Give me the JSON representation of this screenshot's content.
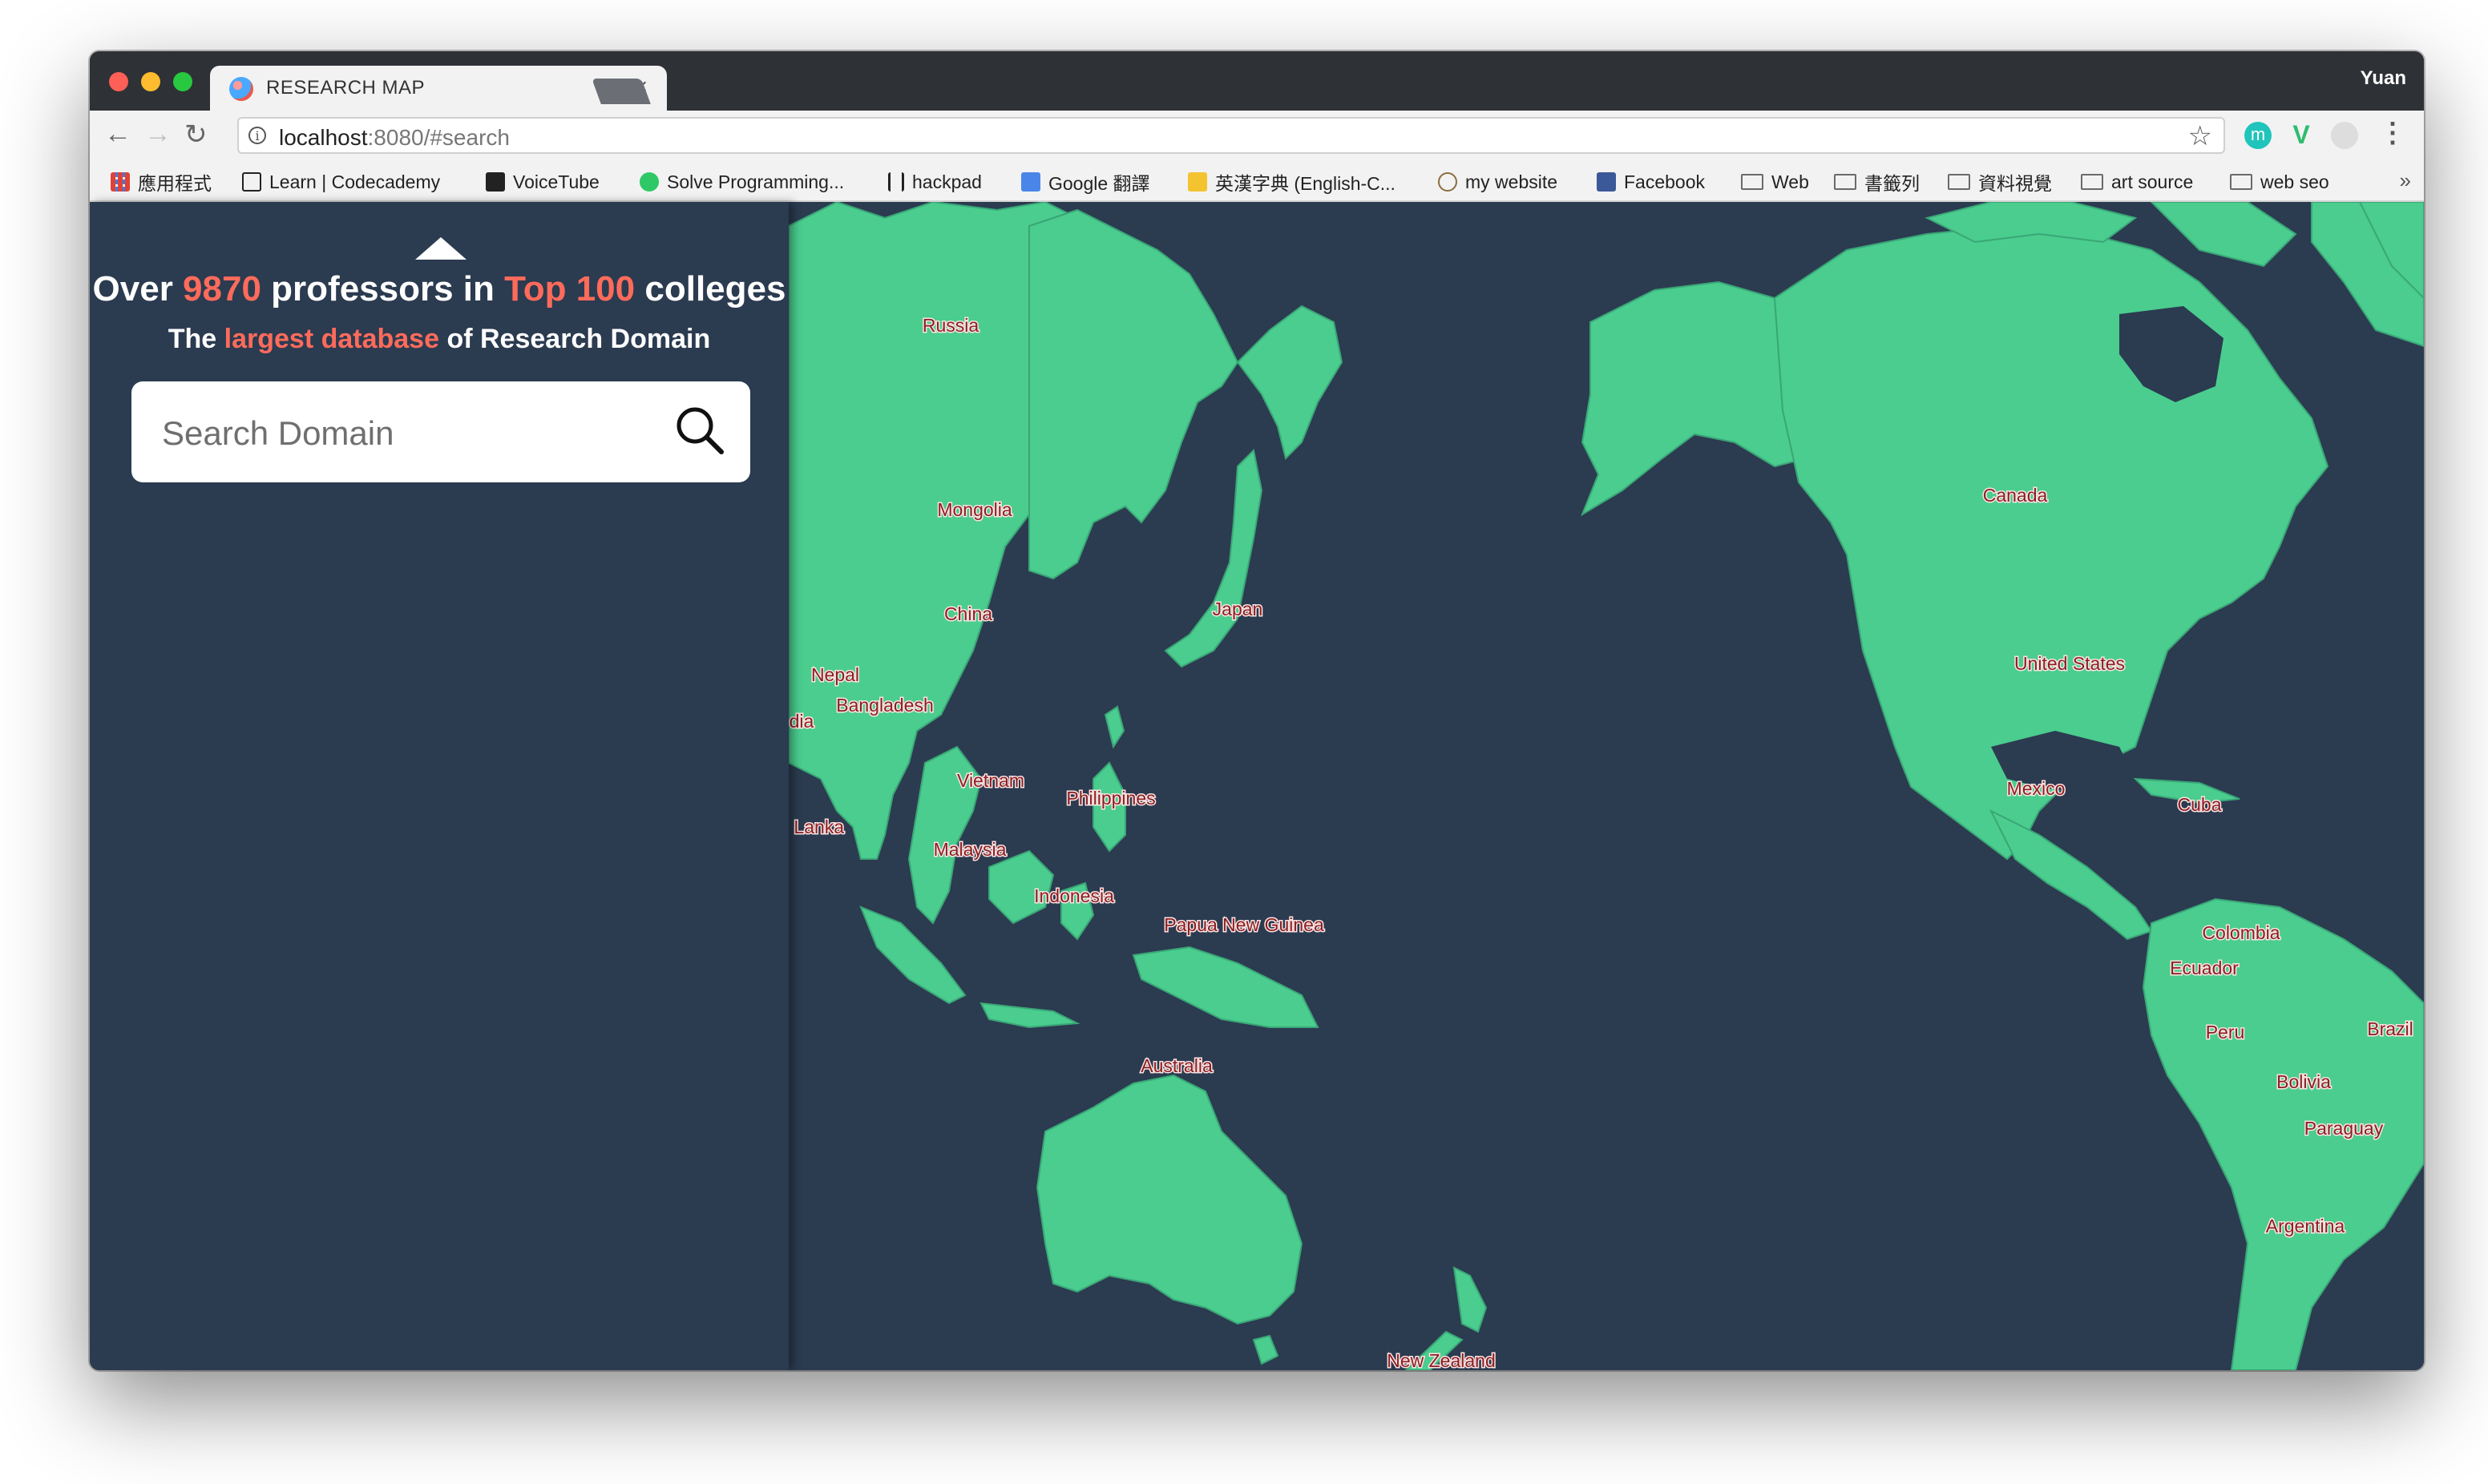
{
  "browser": {
    "tab_title": "RESEARCH MAP",
    "tab_close": "×",
    "profile_name": "Yuan",
    "url_host": "localhost",
    "url_rest": ":8080/#search",
    "nav_back": "←",
    "nav_forward": "→",
    "nav_reload": "↻",
    "star": "☆",
    "menu": "⋮",
    "ext1": "m",
    "ext2": "V",
    "bookmarks_more": "»",
    "bookmarks": [
      {
        "label": "應用程式",
        "icon": "apps-grid-icon"
      },
      {
        "label": "Learn | Codecademy",
        "icon": "codecademy-icon"
      },
      {
        "label": "VoiceTube",
        "icon": "voicetube-icon"
      },
      {
        "label": "Solve Programming...",
        "icon": "hackerrank-icon"
      },
      {
        "label": "hackpad",
        "icon": "hackpad-icon"
      },
      {
        "label": "Google 翻譯",
        "icon": "google-translate-icon"
      },
      {
        "label": "英漢字典 (English-C...",
        "icon": "dictionary-icon"
      },
      {
        "label": "my website",
        "icon": "website-icon"
      },
      {
        "label": "Facebook",
        "icon": "facebook-icon"
      },
      {
        "label": "Web",
        "icon": "folder-icon"
      },
      {
        "label": "書籤列",
        "icon": "folder-icon"
      },
      {
        "label": "資料視覺",
        "icon": "folder-icon"
      },
      {
        "label": "art source",
        "icon": "folder-icon"
      },
      {
        "label": "web seo",
        "icon": "folder-icon"
      }
    ]
  },
  "sidebar": {
    "headline_pre": "Over ",
    "headline_count": "9870",
    "headline_mid": " professors in ",
    "headline_top": "Top 100",
    "headline_post": " colleges",
    "subline_pre": "The ",
    "subline_accent": "largest database",
    "subline_post": " of Research Domain",
    "search_placeholder": "Search Domain"
  },
  "map": {
    "countries": [
      "Russia",
      "Mongolia",
      "China",
      "Japan",
      "Nepal",
      "Bangladesh",
      "dia",
      "Vietnam",
      "Philippines",
      "i Lanka",
      "Malaysia",
      "Indonesia",
      "Papua New Guinea",
      "Australia",
      "New Zealand",
      "Canada",
      "United States",
      "Mexico",
      "Cuba",
      "Colombia",
      "Ecuador",
      "Peru",
      "Brazil",
      "Bolivia",
      "Paraguay",
      "Argentina"
    ]
  },
  "colors": {
    "background": "#2b3b50",
    "land": "#4acd8e",
    "accent": "#ff6b5b",
    "label": "#8a1f22"
  }
}
